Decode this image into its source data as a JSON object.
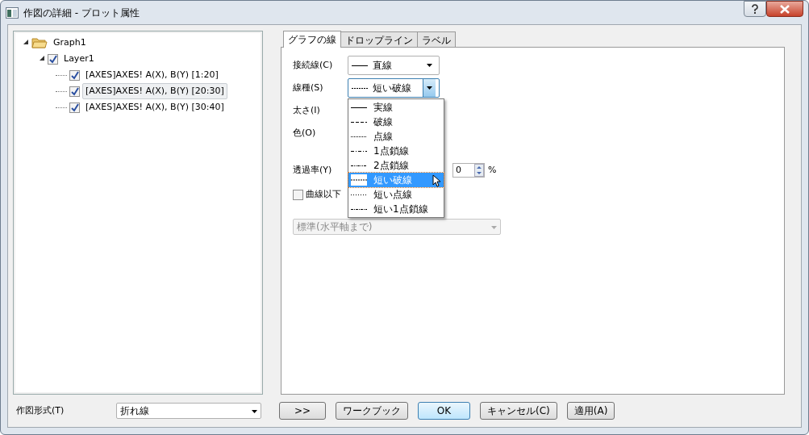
{
  "window": {
    "title": "作図の詳細 - プロット属性"
  },
  "tree": [
    {
      "label": "Graph1",
      "kind": "folder",
      "expanded": true,
      "children": [
        {
          "label": "Layer1",
          "kind": "check",
          "checked": true,
          "expanded": true,
          "children": [
            {
              "label": "[AXES]AXES!  A(X), B(Y) [1:20]",
              "kind": "check",
              "checked": true,
              "selected": false
            },
            {
              "label": "[AXES]AXES!  A(X), B(Y) [20:30]",
              "kind": "check",
              "checked": true,
              "selected": true
            },
            {
              "label": "[AXES]AXES!  A(X), B(Y) [30:40]",
              "kind": "check",
              "checked": true,
              "selected": false
            }
          ]
        }
      ]
    }
  ],
  "tabs": [
    {
      "label": "グラフの線",
      "selected": true
    },
    {
      "label": "ドロップライン",
      "selected": false
    },
    {
      "label": "ラベル",
      "selected": false
    }
  ],
  "connect": {
    "label": "接続線(C)",
    "value": "直線",
    "kind": "solid"
  },
  "line_type": {
    "label": "線種(S)",
    "value": "短い破線",
    "kind": "shortdash"
  },
  "width_label": "太さ(I)",
  "color_label": "色(O)",
  "transparency": {
    "label": "透過率(Y)",
    "value": "0",
    "unit": "%"
  },
  "fill_below": {
    "label": "曲線以下",
    "checked": false
  },
  "fill_mode": {
    "value": "標準(水平軸まで)",
    "disabled": true
  },
  "line_options": [
    {
      "label": "実線",
      "kind": "solid",
      "selected": false
    },
    {
      "label": "破線",
      "kind": "dash",
      "selected": false
    },
    {
      "label": "点線",
      "kind": "dot",
      "selected": false
    },
    {
      "label": "1点鎖線",
      "kind": "dashdot",
      "selected": false
    },
    {
      "label": "2点鎖線",
      "kind": "dashdotdot",
      "selected": false
    },
    {
      "label": "短い破線",
      "kind": "shortdash",
      "selected": true
    },
    {
      "label": "短い点線",
      "kind": "shortdot",
      "selected": false
    },
    {
      "label": "短い1点鎖線",
      "kind": "shortdashdot",
      "selected": false
    }
  ],
  "plot_type": {
    "label": "作図形式(T)",
    "value": "折れ線"
  },
  "buttons": [
    {
      "label": ">>",
      "kind": "normal"
    },
    {
      "label": "ワークブック",
      "kind": "normal"
    },
    {
      "label": "OK",
      "kind": "default"
    },
    {
      "label": "キャンセル(C)",
      "kind": "normal"
    },
    {
      "label": "適用(A)",
      "kind": "normal"
    }
  ]
}
